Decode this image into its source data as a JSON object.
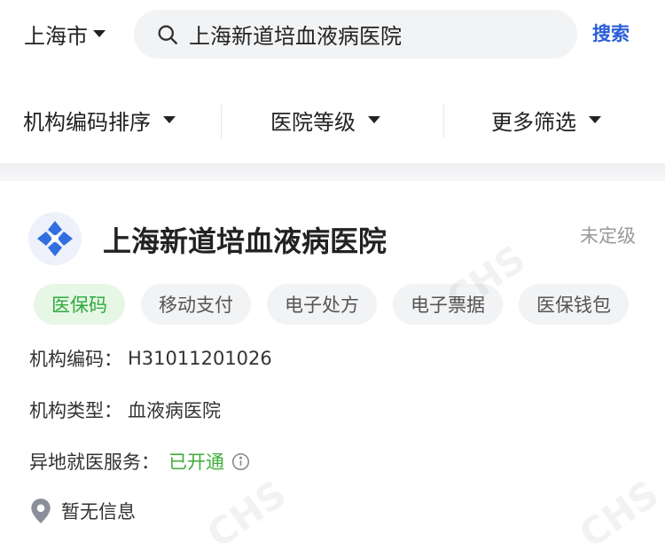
{
  "header": {
    "city": "上海市",
    "search_value": "上海新道培血液病医院",
    "search_button": "搜索"
  },
  "filters": [
    {
      "label": "机构编码排序"
    },
    {
      "label": "医院等级"
    },
    {
      "label": "更多筛选"
    }
  ],
  "hospital": {
    "name": "上海新道培血液病医院",
    "level": "未定级",
    "tags": [
      "医保码",
      "移动支付",
      "电子处方",
      "电子票据",
      "医保钱包"
    ],
    "code_label": "机构编码：",
    "code_value": "H31011201026",
    "type_label": "机构类型：",
    "type_value": "血液病医院",
    "remote_label": "异地就医服务：",
    "remote_value": "已开通",
    "location": "暂无信息"
  },
  "colors": {
    "accent": "#2a5dd8",
    "active_tag_bg": "#e7f7e6",
    "active_tag_text": "#2eaa3c",
    "status_green": "#3fae3a"
  },
  "watermark": "CHS"
}
